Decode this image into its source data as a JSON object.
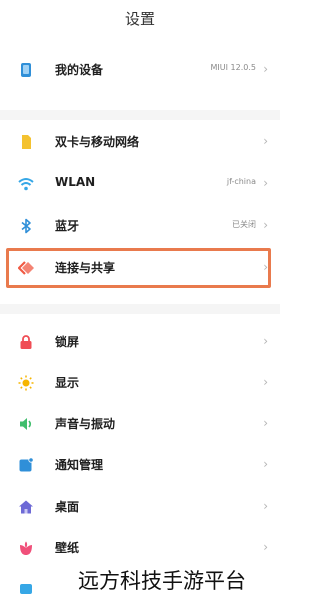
{
  "header": {
    "title": "设置"
  },
  "settings": {
    "device": {
      "label": "我的设备",
      "value": "MIUI 12.0.5"
    },
    "sim": {
      "label": "双卡与移动网络"
    },
    "wlan": {
      "label": "WLAN",
      "value": "jf-china"
    },
    "bluetooth": {
      "label": "蓝牙",
      "value": "已关闭"
    },
    "connect": {
      "label": "连接与共享"
    },
    "lockscreen": {
      "label": "锁屏"
    },
    "display": {
      "label": "显示"
    },
    "sound": {
      "label": "声音与振动"
    },
    "notifications": {
      "label": "通知管理"
    },
    "desktop": {
      "label": "桌面"
    },
    "wallpaper": {
      "label": "壁纸"
    }
  },
  "chevron": "›",
  "watermark": "远方科技手游平台",
  "colors": {
    "highlight_border": "#e97a4d",
    "device_icon": "#2f8fd8",
    "sim_icon": "#f4c230",
    "wlan_icon": "#36a7e6",
    "bluetooth_icon": "#2f8fd8",
    "connect_icon": "#f05a44",
    "lock_icon": "#f04d55",
    "display_icon": "#f6b500",
    "sound_icon": "#3fbe6c",
    "notification_icon": "#2f8fd8",
    "desktop_icon": "#6e6ad6",
    "wallpaper_icon": "#f0507a"
  }
}
